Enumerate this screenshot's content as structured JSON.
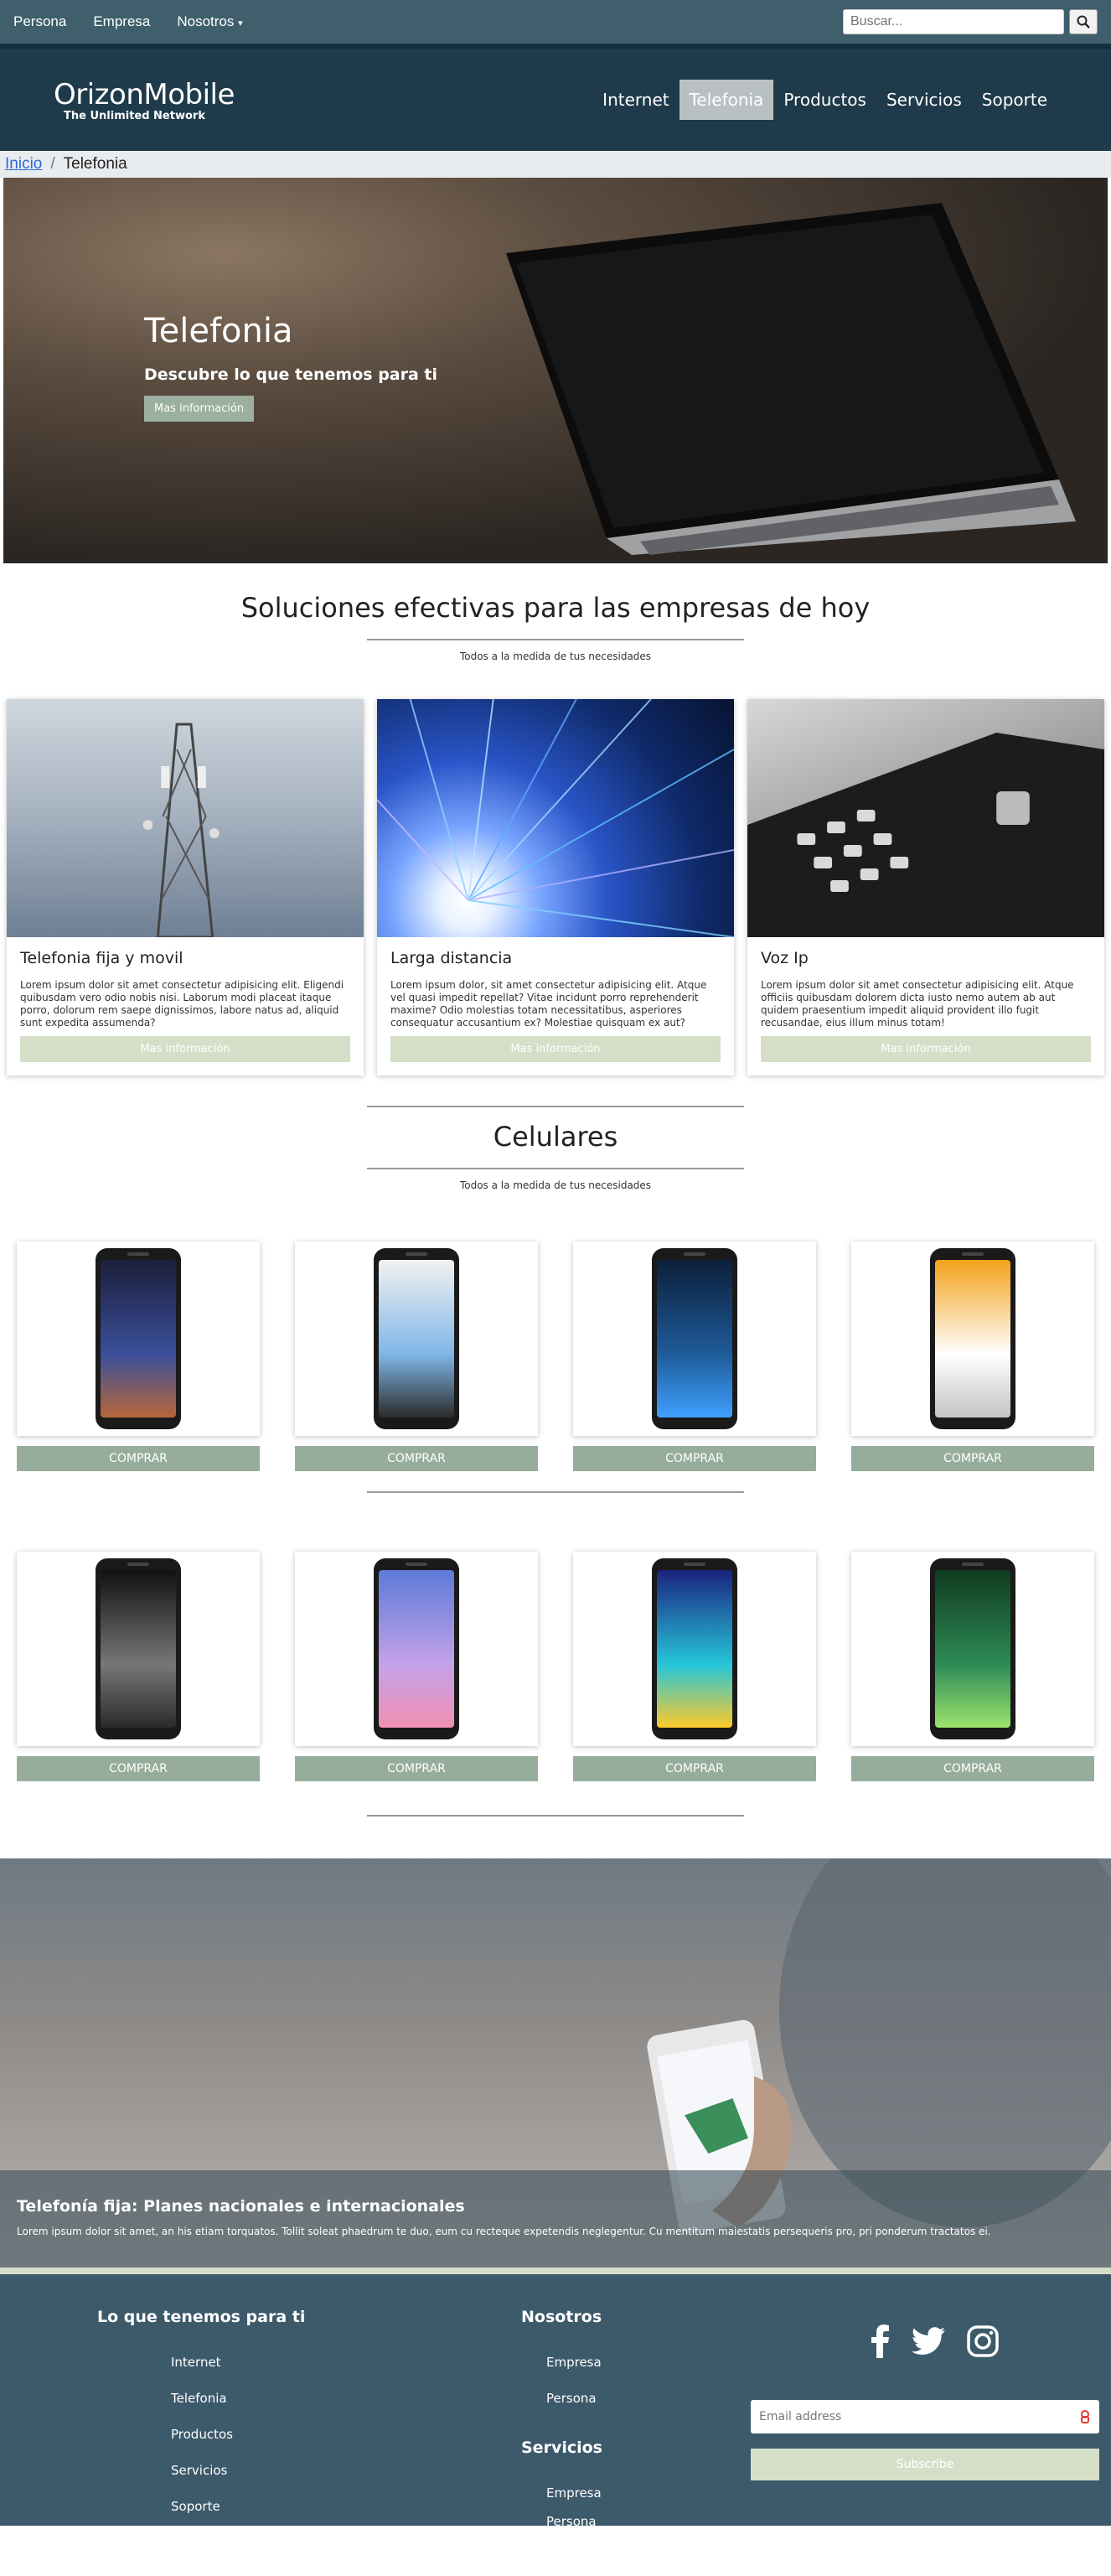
{
  "topbar": {
    "links": [
      "Persona",
      "Empresa",
      "Nosotros"
    ],
    "search_placeholder": "Buscar..."
  },
  "header": {
    "brand": "OrizonMobile",
    "tagline": "The Unlimited Network",
    "nav": [
      "Internet",
      "Telefonia",
      "Productos",
      "Servicios",
      "Soporte"
    ],
    "active": "Telefonia"
  },
  "breadcrumb": {
    "home": "Inicio",
    "current": "Telefonia"
  },
  "hero": {
    "title": "Telefonia",
    "subtitle": "Descubre lo que tenemos para ti",
    "button": "Mas información"
  },
  "solutions": {
    "title": "Soluciones efectivas para las empresas de hoy",
    "subtitle": "Todos a la medida de tus necesidades",
    "cards": [
      {
        "title": "Telefonia fija y movil",
        "text": "Lorem ipsum dolor sit amet consectetur adipisicing elit. Eligendi quibusdam vero odio nobis nisi. Laborum modi placeat itaque porro, dolorum rem saepe dignissimos, labore natus ad, aliquid sunt expedita assumenda?",
        "button": "Mas información"
      },
      {
        "title": "Larga distancia",
        "text": "Lorem ipsum dolor, sit amet consectetur adipisicing elit. Atque vel quasi impedit repellat? Vitae incidunt porro reprehenderit maxime? Odio molestias totam necessitatibus, asperiores consequatur accusantium ex? Molestiae quisquam ex aut?",
        "button": "Mas información"
      },
      {
        "title": "Voz Ip",
        "text": "Lorem ipsum dolor sit amet consectetur adipisicing elit. Atque officiis quibusdam dolorem dicta iusto nemo autem ab aut quidem praesentium impedit aliquid provident illo fugit recusandae, eius illum minus totam!",
        "button": "Mas información"
      }
    ]
  },
  "phones": {
    "title": "Celulares",
    "subtitle": "Todos a la medida de tus necesidades",
    "buy_label": "COMPRAR",
    "row1": [
      "night",
      "classic",
      "blue",
      "orange"
    ],
    "row2": [
      "dark",
      "violet",
      "gradient",
      "green"
    ]
  },
  "banner": {
    "title": "Telefonía fija: Planes nacionales e internacionales",
    "text": "Lorem ipsum dolor sit amet, an his etiam torquatos. Tollit soleat phaedrum te duo, eum cu recteque expetendis neglegentur. Cu mentitum maiestatis persequeris pro, pri ponderum tractatos ei."
  },
  "footer": {
    "col1_title": "Lo que tenemos para ti",
    "col1_links": [
      "Internet",
      "Telefonia",
      "Productos",
      "Servicios",
      "Soporte"
    ],
    "col2_title": "Nosotros",
    "col2_links": [
      "Empresa",
      "Persona"
    ],
    "col3_title": "Servicios",
    "col3_links": [
      "Empresa",
      "Persona"
    ],
    "email_placeholder": "Email address",
    "subscribe": "Subscribe"
  }
}
